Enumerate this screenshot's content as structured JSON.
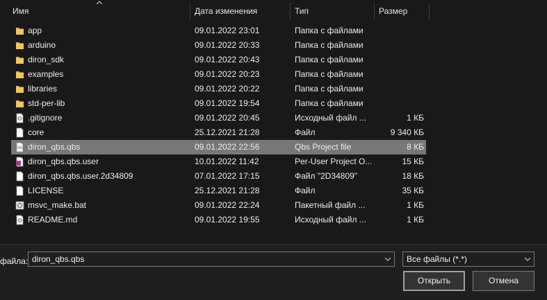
{
  "columns": {
    "name": "Имя",
    "date": "Дата изменения",
    "type": "Тип",
    "size": "Размер"
  },
  "files": [
    {
      "name": "app",
      "date": "09.01.2022 23:01",
      "type": "Папка с файлами",
      "size": "",
      "icon": "folder-icon"
    },
    {
      "name": "arduino",
      "date": "09.01.2022 20:33",
      "type": "Папка с файлами",
      "size": "",
      "icon": "folder-icon"
    },
    {
      "name": "diron_sdk",
      "date": "09.01.2022 20:43",
      "type": "Папка с файлами",
      "size": "",
      "icon": "folder-icon"
    },
    {
      "name": "examples",
      "date": "09.01.2022 20:23",
      "type": "Папка с файлами",
      "size": "",
      "icon": "folder-icon"
    },
    {
      "name": "libraries",
      "date": "09.01.2022 20:22",
      "type": "Папка с файлами",
      "size": "",
      "icon": "folder-icon"
    },
    {
      "name": "std-per-lib",
      "date": "09.01.2022 19:54",
      "type": "Папка с файлами",
      "size": "",
      "icon": "folder-icon"
    },
    {
      "name": ".gitignore",
      "date": "09.01.2022 20:45",
      "type": "Исходный файл ...",
      "size": "1 КБ",
      "icon": "source-file-icon"
    },
    {
      "name": "core",
      "date": "25.12.2021 21:28",
      "type": "Файл",
      "size": "9 340 КБ",
      "icon": "file-icon"
    },
    {
      "name": "diron_qbs.qbs",
      "date": "09.01.2022 22:56",
      "type": "Qbs Project file",
      "size": "8 КБ",
      "icon": "qbs-project-icon",
      "selected": true
    },
    {
      "name": "diron_qbs.qbs.user",
      "date": "10.01.2022 11:42",
      "type": "Per-User Project O...",
      "size": "15 КБ",
      "icon": "user-project-icon"
    },
    {
      "name": "diron_qbs.qbs.user.2d34809",
      "date": "07.01.2022 17:15",
      "type": "Файл \"2D34809\"",
      "size": "18 КБ",
      "icon": "file-icon"
    },
    {
      "name": "LICENSE",
      "date": "25.12.2021 21:28",
      "type": "Файл",
      "size": "35 КБ",
      "icon": "file-icon"
    },
    {
      "name": "msvc_make.bat",
      "date": "09.01.2022 22:24",
      "type": "Пакетный файл ...",
      "size": "1 КБ",
      "icon": "batch-file-icon"
    },
    {
      "name": "README.md",
      "date": "09.01.2022 19:55",
      "type": "Исходный файл ...",
      "size": "1 КБ",
      "icon": "source-file-icon"
    }
  ],
  "bottom": {
    "filename_label": "файла:",
    "filename_value": "diron_qbs.qbs",
    "filetype_value": "Все файлы (*.*)",
    "open_label": "Открыть",
    "cancel_label": "Отмена"
  },
  "colors": {
    "background": "#191919",
    "selection": "#777777",
    "folder": "#e8b84b"
  }
}
